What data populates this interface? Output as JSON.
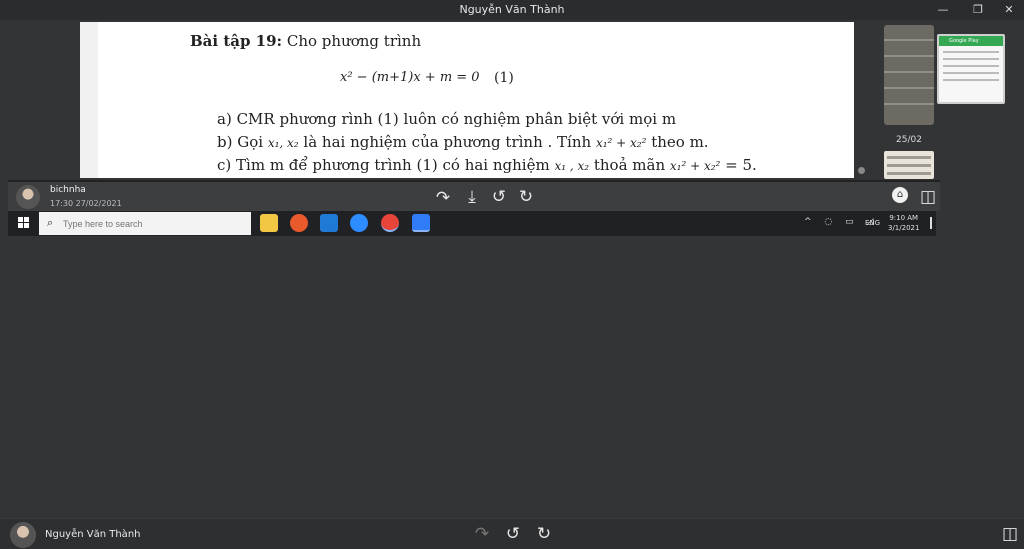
{
  "window": {
    "title": "Nguyễn Văn Thành",
    "controls": {
      "minimize": "—",
      "maximize": "❐",
      "close": "✕"
    }
  },
  "document": {
    "heading_bold": "Bài tập 19:",
    "heading_rest": "Cho phương trình",
    "equation": "x² − (m+1)x + m = 0",
    "equation_number": "(1)",
    "item_a": "a)  CMR phương rình (1) luôn có nghiệm phân biệt với mọi m",
    "item_b_pre": "b)  Gọi",
    "item_b_vars": "x₁, x₂",
    "item_b_mid": "là hai nghiệm của phương trình . Tính",
    "item_b_expr": "x₁² + x₂²",
    "item_b_post": "theo m.",
    "item_c_pre": "c)  Tìm m để phương trình (1) có hai nghiệm",
    "item_c_vars": "x₁ , x₂",
    "item_c_mid": "thoả mãn",
    "item_c_expr": "x₁² + x₂²",
    "item_c_post": "= 5."
  },
  "thumbnails": {
    "date_label": "25/02",
    "play_header": "Google Play"
  },
  "message": {
    "sender": "bichnha",
    "time": "17:30 27/02/2021",
    "icons": [
      "forward-icon",
      "download-icon",
      "rotate-left-icon",
      "rotate-right-icon",
      "info-icon",
      "layout-icon"
    ]
  },
  "taskbar": {
    "search_placeholder": "Type here to search",
    "lang": "ENG",
    "clock_time": "9:10 AM",
    "clock_date": "3/1/2021",
    "apps": [
      "file-explorer-icon",
      "firefox-icon",
      "mail-icon",
      "zoom-icon",
      "chrome-icon",
      "zalo-icon"
    ],
    "colors": {
      "explorer": "#f2c744",
      "firefox": "#e8592b",
      "mail": "#1f7ad6",
      "zoom": "#2d8cff",
      "chrome": "#e7443a",
      "zalo": "#2f7cf6"
    }
  },
  "bottom": {
    "user": "Nguyễn Văn Thành"
  }
}
